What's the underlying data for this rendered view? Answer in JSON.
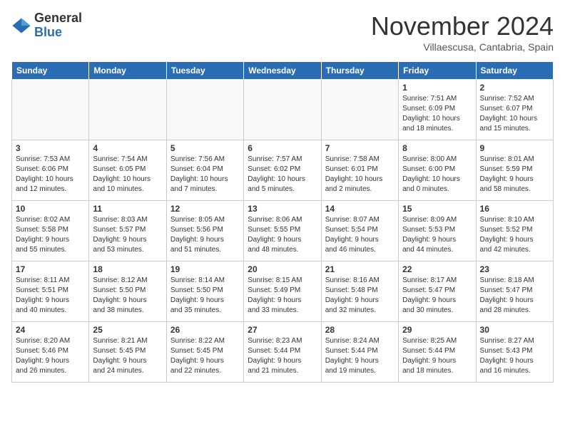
{
  "header": {
    "logo_general": "General",
    "logo_blue": "Blue",
    "month": "November 2024",
    "location": "Villaescusa, Cantabria, Spain"
  },
  "weekdays": [
    "Sunday",
    "Monday",
    "Tuesday",
    "Wednesday",
    "Thursday",
    "Friday",
    "Saturday"
  ],
  "weeks": [
    [
      {
        "day": "",
        "info": ""
      },
      {
        "day": "",
        "info": ""
      },
      {
        "day": "",
        "info": ""
      },
      {
        "day": "",
        "info": ""
      },
      {
        "day": "",
        "info": ""
      },
      {
        "day": "1",
        "info": "Sunrise: 7:51 AM\nSunset: 6:09 PM\nDaylight: 10 hours\nand 18 minutes."
      },
      {
        "day": "2",
        "info": "Sunrise: 7:52 AM\nSunset: 6:07 PM\nDaylight: 10 hours\nand 15 minutes."
      }
    ],
    [
      {
        "day": "3",
        "info": "Sunrise: 7:53 AM\nSunset: 6:06 PM\nDaylight: 10 hours\nand 12 minutes."
      },
      {
        "day": "4",
        "info": "Sunrise: 7:54 AM\nSunset: 6:05 PM\nDaylight: 10 hours\nand 10 minutes."
      },
      {
        "day": "5",
        "info": "Sunrise: 7:56 AM\nSunset: 6:04 PM\nDaylight: 10 hours\nand 7 minutes."
      },
      {
        "day": "6",
        "info": "Sunrise: 7:57 AM\nSunset: 6:02 PM\nDaylight: 10 hours\nand 5 minutes."
      },
      {
        "day": "7",
        "info": "Sunrise: 7:58 AM\nSunset: 6:01 PM\nDaylight: 10 hours\nand 2 minutes."
      },
      {
        "day": "8",
        "info": "Sunrise: 8:00 AM\nSunset: 6:00 PM\nDaylight: 10 hours\nand 0 minutes."
      },
      {
        "day": "9",
        "info": "Sunrise: 8:01 AM\nSunset: 5:59 PM\nDaylight: 9 hours\nand 58 minutes."
      }
    ],
    [
      {
        "day": "10",
        "info": "Sunrise: 8:02 AM\nSunset: 5:58 PM\nDaylight: 9 hours\nand 55 minutes."
      },
      {
        "day": "11",
        "info": "Sunrise: 8:03 AM\nSunset: 5:57 PM\nDaylight: 9 hours\nand 53 minutes."
      },
      {
        "day": "12",
        "info": "Sunrise: 8:05 AM\nSunset: 5:56 PM\nDaylight: 9 hours\nand 51 minutes."
      },
      {
        "day": "13",
        "info": "Sunrise: 8:06 AM\nSunset: 5:55 PM\nDaylight: 9 hours\nand 48 minutes."
      },
      {
        "day": "14",
        "info": "Sunrise: 8:07 AM\nSunset: 5:54 PM\nDaylight: 9 hours\nand 46 minutes."
      },
      {
        "day": "15",
        "info": "Sunrise: 8:09 AM\nSunset: 5:53 PM\nDaylight: 9 hours\nand 44 minutes."
      },
      {
        "day": "16",
        "info": "Sunrise: 8:10 AM\nSunset: 5:52 PM\nDaylight: 9 hours\nand 42 minutes."
      }
    ],
    [
      {
        "day": "17",
        "info": "Sunrise: 8:11 AM\nSunset: 5:51 PM\nDaylight: 9 hours\nand 40 minutes."
      },
      {
        "day": "18",
        "info": "Sunrise: 8:12 AM\nSunset: 5:50 PM\nDaylight: 9 hours\nand 38 minutes."
      },
      {
        "day": "19",
        "info": "Sunrise: 8:14 AM\nSunset: 5:50 PM\nDaylight: 9 hours\nand 35 minutes."
      },
      {
        "day": "20",
        "info": "Sunrise: 8:15 AM\nSunset: 5:49 PM\nDaylight: 9 hours\nand 33 minutes."
      },
      {
        "day": "21",
        "info": "Sunrise: 8:16 AM\nSunset: 5:48 PM\nDaylight: 9 hours\nand 32 minutes."
      },
      {
        "day": "22",
        "info": "Sunrise: 8:17 AM\nSunset: 5:47 PM\nDaylight: 9 hours\nand 30 minutes."
      },
      {
        "day": "23",
        "info": "Sunrise: 8:18 AM\nSunset: 5:47 PM\nDaylight: 9 hours\nand 28 minutes."
      }
    ],
    [
      {
        "day": "24",
        "info": "Sunrise: 8:20 AM\nSunset: 5:46 PM\nDaylight: 9 hours\nand 26 minutes."
      },
      {
        "day": "25",
        "info": "Sunrise: 8:21 AM\nSunset: 5:45 PM\nDaylight: 9 hours\nand 24 minutes."
      },
      {
        "day": "26",
        "info": "Sunrise: 8:22 AM\nSunset: 5:45 PM\nDaylight: 9 hours\nand 22 minutes."
      },
      {
        "day": "27",
        "info": "Sunrise: 8:23 AM\nSunset: 5:44 PM\nDaylight: 9 hours\nand 21 minutes."
      },
      {
        "day": "28",
        "info": "Sunrise: 8:24 AM\nSunset: 5:44 PM\nDaylight: 9 hours\nand 19 minutes."
      },
      {
        "day": "29",
        "info": "Sunrise: 8:25 AM\nSunset: 5:44 PM\nDaylight: 9 hours\nand 18 minutes."
      },
      {
        "day": "30",
        "info": "Sunrise: 8:27 AM\nSunset: 5:43 PM\nDaylight: 9 hours\nand 16 minutes."
      }
    ]
  ]
}
